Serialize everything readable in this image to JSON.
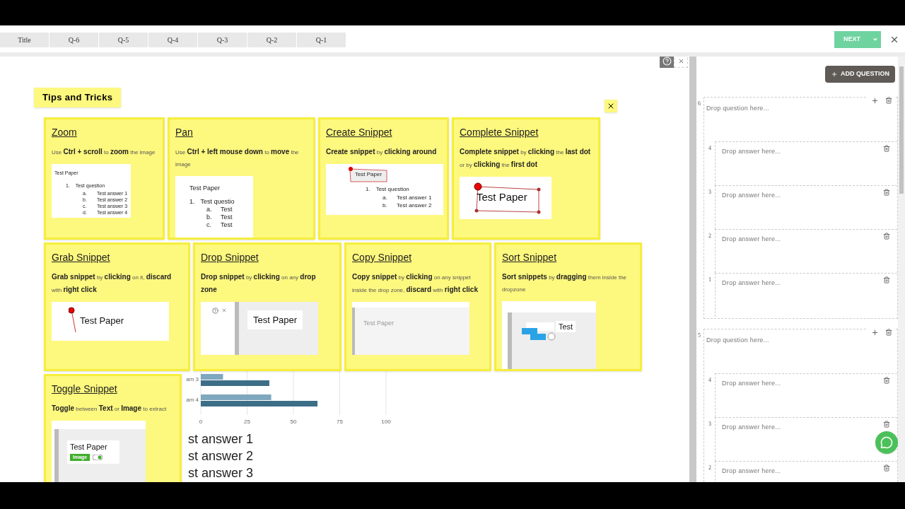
{
  "tabs": [
    {
      "label": "Title",
      "selected": false
    },
    {
      "label": "Q-6",
      "selected": false
    },
    {
      "label": "Q-5",
      "selected": false
    },
    {
      "label": "Q-4",
      "selected": false
    },
    {
      "label": "Q-3",
      "selected": false
    },
    {
      "label": "Q-2",
      "selected": false
    },
    {
      "label": "Q-1",
      "selected": false
    }
  ],
  "next_button": "NEXT",
  "background": {
    "chart_data": {
      "type": "bar",
      "orientation": "horizontal",
      "categories": [
        "am 3",
        "am 4"
      ],
      "series": [
        {
          "color": "#7fa7bd",
          "values": [
            12,
            38
          ]
        },
        {
          "color": "#3d6e87",
          "values": [
            37,
            63
          ]
        }
      ],
      "xlim": [
        0,
        100
      ],
      "grid": true,
      "xticks": [
        0,
        25,
        50,
        75,
        100
      ]
    },
    "answers": [
      "st answer 1",
      "st answer 2",
      "st answer 3"
    ]
  },
  "tips": {
    "title": "Tips and Tricks",
    "cards": [
      {
        "title": "Zoom",
        "description": "Use **Ctrl + scroll** to **zoom** the image",
        "preview": {
          "kind": "document",
          "title": "Test Paper",
          "question": {
            "marker": "1.",
            "text": "Test question"
          },
          "answers": [
            {
              "marker": "a.",
              "text": "Test answer 1"
            },
            {
              "marker": "b.",
              "text": "Test answer 2"
            },
            {
              "marker": "c.",
              "text": "Test answer 3"
            },
            {
              "marker": "d.",
              "text": "Test answer 4"
            }
          ]
        }
      },
      {
        "title": "Pan",
        "description": "Use **Ctrl + left mouse down** to **move** the image",
        "preview": {
          "kind": "pan",
          "title": "Test Paper",
          "question": {
            "marker": "1.",
            "text": "Test questio"
          },
          "answers": [
            {
              "marker": "a.",
              "text": "Test"
            },
            {
              "marker": "b.",
              "text": "Test"
            },
            {
              "marker": "c.",
              "text": "Test"
            }
          ]
        }
      },
      {
        "title": "Create Snippet",
        "description": "**Create snippet** by **clicking around**",
        "preview": {
          "kind": "selection",
          "title": "Test Paper",
          "question": {
            "marker": "1.",
            "text": "Test question"
          },
          "answers": [
            {
              "marker": "a.",
              "text": "Test answer 1"
            },
            {
              "marker": "b.",
              "text": "Test answer 2"
            }
          ]
        }
      },
      {
        "title": "Complete Snippet",
        "description": "**Complete snippet** by **clicking** the **last dot** or by **clicking** the **first dot**",
        "preview": {
          "kind": "complete",
          "title": "Test Paper"
        }
      },
      {
        "title": "Grab Snippet",
        "description": "**Grab snippet** by **clicking** on it, **discard** with **right click**",
        "preview": {
          "kind": "grab",
          "title": "Test Paper"
        }
      },
      {
        "title": "Drop Snippet",
        "description": "**Drop snippet** by **clicking** on any **drop zone**",
        "preview": {
          "kind": "drop",
          "title": "Test Paper"
        }
      },
      {
        "title": "Copy Snippet",
        "description": "**Copy snippet** by **clicking** on any snippet inside the drop zone, **discard** with **right click**",
        "preview": {
          "kind": "copy",
          "title": "Test Paper"
        }
      },
      {
        "title": "Sort Snippet",
        "description": "**Sort snippets** by **dragging** them inside the dropzone",
        "preview": {
          "kind": "sort",
          "title": "Test"
        }
      },
      {
        "title": "Toggle Snippet",
        "description": "**Toggle** between **Text** or **Image** to extract",
        "preview": {
          "kind": "toggle",
          "title": "Test Paper",
          "chip": "Image"
        }
      }
    ]
  },
  "add_question_button": "ADD QUESTION",
  "questions": [
    {
      "number": "6",
      "prompt": "Drop question here...",
      "answers": [
        {
          "number": "4",
          "prompt": "Drop answer here..."
        },
        {
          "number": "3",
          "prompt": "Drop answer here..."
        },
        {
          "number": "2",
          "prompt": "Drop answer here..."
        },
        {
          "number": "1",
          "prompt": "Drop answer here..."
        }
      ]
    },
    {
      "number": "5",
      "prompt": "Drop question here...",
      "answers": [
        {
          "number": "4",
          "prompt": "Drop answer here..."
        },
        {
          "number": "3",
          "prompt": "Drop answer here..."
        },
        {
          "number": "2",
          "prompt": "Drop answer here..."
        }
      ]
    }
  ]
}
